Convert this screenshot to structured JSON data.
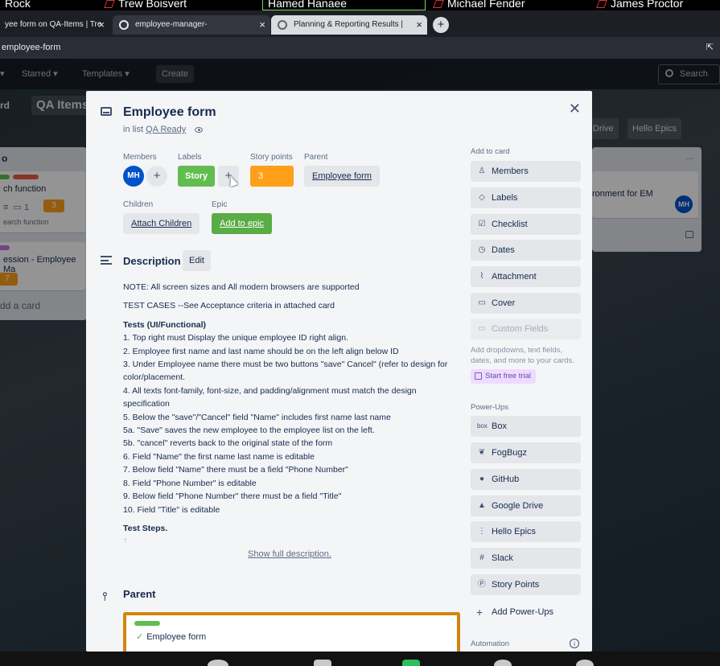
{
  "participants": [
    "Rock",
    "Trew Boisvert",
    "Hamed Hanaee",
    "Michael Fender",
    "James Proctor"
  ],
  "browser": {
    "tabs": [
      {
        "title": "yee form on QA-Items | Tre"
      },
      {
        "title": "employee-manager-"
      },
      {
        "title": "Planning & Reporting Results | "
      }
    ],
    "address": "employee-form"
  },
  "board": {
    "nav": {
      "starred": "Starred",
      "templates": "Templates",
      "create": "Create",
      "search": "Search"
    },
    "board_label": "rd",
    "board_name": "QA Items",
    "pills": [
      "Drive",
      "Hello Epics"
    ],
    "list_header": "o",
    "list_dots": "...",
    "cards": {
      "c1": "ch function",
      "c1_badges": "1",
      "c1_sp": "3",
      "c1_sub": "earch function",
      "c2": "ession - Employee Ma",
      "c2_sp": "7",
      "add": "dd a card",
      "right": "ronment for EM",
      "right_avatar": "MH"
    }
  },
  "card": {
    "title": "Employee form",
    "in_list_prefix": "in list",
    "list_name": "QA Ready",
    "members_label": "Members",
    "member_initials": "MH",
    "labels_label": "Labels",
    "label_story": "Story",
    "story_points_label": "Story points",
    "story_points": "3",
    "parent_label": "Parent",
    "parent_value": "Employee form",
    "children_label": "Children",
    "attach_children": "Attach Children",
    "epic_label": "Epic",
    "add_to_epic": "Add to epic",
    "description_title": "Description",
    "edit": "Edit",
    "description": {
      "line1": "NOTE: All screen sizes and All modern browsers are supported",
      "line2": "TEST CASES --See Acceptance criteria in attached card",
      "tests_heading": "Tests (UI/Functional)",
      "items": [
        "1. Top right must Display the unique employee ID right align.",
        "2. Employee first name and last name should be on the left align below ID",
        "3. Under Employee name there must be two buttons \"save\" Cancel\" (refer to design for color/placement.",
        "4. All texts font-family, font-size, and padding/alignment must match the design specification",
        "5. Below the \"save\"/\"Cancel\" field \"Name\" includes first name last name",
        "5a. \"Save\" saves the new employee to the employee list on the left.",
        "5b. \"cancel\" reverts back to the original state of the form",
        "6. Field \"Name\" the first name last name is editable",
        "7. Below field \"Name\" there must be a field \"Phone Number\"",
        "8. Field \"Phone Number\" is editable",
        "9. Below field \"Phone Number\" there must be a field \"Title\"",
        "10. Field \"Title\" is editable"
      ],
      "steps_heading": "Test Steps.",
      "fade": "1."
    },
    "show_full": "Show full description.",
    "parent_section": "Parent",
    "parent_card_title": "Employee form"
  },
  "sidebar": {
    "add_to_card": "Add to card",
    "buttons": [
      {
        "label": "Members",
        "icon": "person-icon"
      },
      {
        "label": "Labels",
        "icon": "tag-icon"
      },
      {
        "label": "Checklist",
        "icon": "checkbox-icon"
      },
      {
        "label": "Dates",
        "icon": "clock-icon"
      },
      {
        "label": "Attachment",
        "icon": "paperclip-icon"
      },
      {
        "label": "Cover",
        "icon": "cover-icon"
      },
      {
        "label": "Custom Fields",
        "icon": "custom-fields-icon"
      }
    ],
    "custom_fields_note": "Add dropdowns, text fields, dates, and more to your cards.",
    "start_trial": "Start free trial",
    "power_ups": "Power-Ups",
    "powerups": [
      {
        "label": "Box",
        "icon": "box-icon"
      },
      {
        "label": "FogBugz",
        "icon": "fogbugz-icon"
      },
      {
        "label": "GitHub",
        "icon": "github-icon"
      },
      {
        "label": "Google Drive",
        "icon": "google-drive-icon"
      },
      {
        "label": "Hello Epics",
        "icon": "hello-epics-icon"
      },
      {
        "label": "Slack",
        "icon": "slack-icon"
      },
      {
        "label": "Story Points",
        "icon": "story-points-icon"
      }
    ],
    "add_power_ups": "Add Power-Ups",
    "automation": "Automation"
  },
  "colors": {
    "story_label": "#61bd4f",
    "story_points": "#ff9f1a",
    "epic_button": "#5aac44",
    "avatar": "#0052cc"
  }
}
